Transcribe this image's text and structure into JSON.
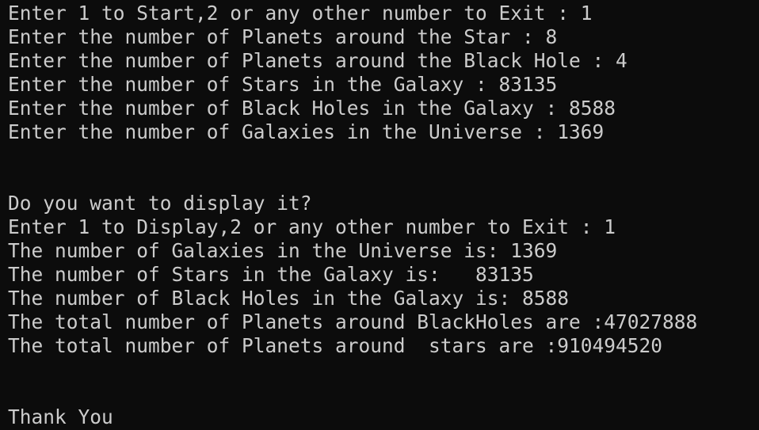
{
  "console": {
    "lines": [
      "Enter 1 to Start,2 or any other number to Exit : 1",
      "Enter the number of Planets around the Star : 8",
      "Enter the number of Planets around the Black Hole : 4",
      "Enter the number of Stars in the Galaxy : 83135",
      "Enter the number of Black Holes in the Galaxy : 8588",
      "Enter the number of Galaxies in the Universe : 1369",
      "",
      "",
      "Do you want to display it?",
      "Enter 1 to Display,2 or any other number to Exit : 1",
      "The number of Galaxies in the Universe is: 1369",
      "The number of Stars in the Galaxy is:   83135",
      "The number of Black Holes in the Galaxy is: 8588",
      "The total number of Planets around BlackHoles are :47027888",
      "The total number of Planets around  stars are :910494520",
      "",
      "",
      "Thank You"
    ]
  },
  "colors": {
    "background": "#0c0c0c",
    "text": "#cccccc"
  }
}
